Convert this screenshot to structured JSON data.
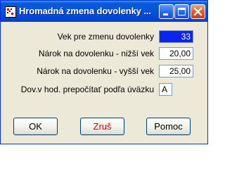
{
  "window": {
    "title": "Hromadná zmena dovolenky ..."
  },
  "titlebar_buttons": {
    "minimize_icon": "minimize-icon",
    "maximize_icon": "maximize-icon",
    "close_icon": "close-icon"
  },
  "form": {
    "rows": [
      {
        "label": "Vek pre zmenu dovolenky",
        "value": "33"
      },
      {
        "label": "Nárok na dovolenku - nižší vek",
        "value": "20,00"
      },
      {
        "label": "Nárok na dovolenku - vyšší vek",
        "value": "25,00"
      },
      {
        "label": "Dov.v hod. prepočítať podľa úväzku",
        "value": "A"
      }
    ]
  },
  "buttons": {
    "ok": "OK",
    "cancel": "Zruš",
    "help": "Pomoc"
  },
  "colors": {
    "title_bar": "#0054e3",
    "selected_field": "#0a24f5",
    "cancel_text": "#d40000",
    "dialog_bg": "#ece9d8"
  }
}
